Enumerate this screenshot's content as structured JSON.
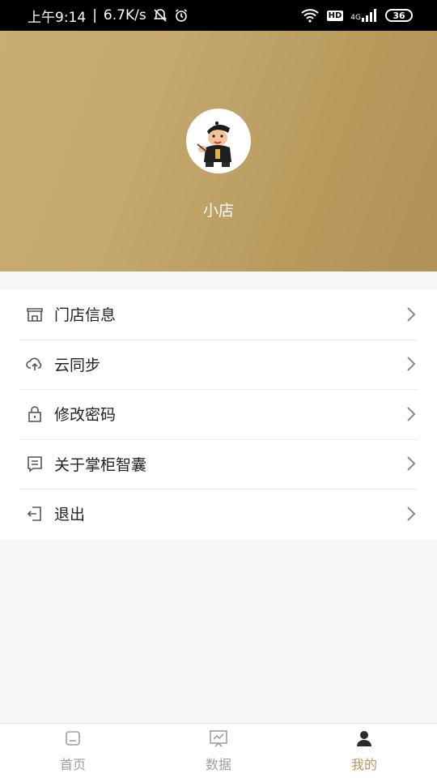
{
  "status_bar": {
    "time": "上午9:14",
    "separator": "|",
    "speed": "6.7K/s",
    "network_badge": "HD",
    "cell_label": "4G",
    "battery": "36"
  },
  "profile": {
    "shop_name": "小店"
  },
  "menu": {
    "items": [
      {
        "label": "门店信息",
        "icon": "store-icon"
      },
      {
        "label": "云同步",
        "icon": "cloud-sync-icon"
      },
      {
        "label": "修改密码",
        "icon": "lock-icon"
      },
      {
        "label": "关于掌柜智囊",
        "icon": "about-icon"
      },
      {
        "label": "退出",
        "icon": "logout-icon"
      }
    ]
  },
  "tabbar": {
    "tabs": [
      {
        "label": "首页",
        "icon": "home-icon",
        "active": false
      },
      {
        "label": "数据",
        "icon": "data-chart-icon",
        "active": false
      },
      {
        "label": "我的",
        "icon": "profile-icon",
        "active": true
      }
    ]
  },
  "colors": {
    "accent": "#b59a60",
    "hero_start": "#c9ad72",
    "hero_end": "#b0925a",
    "inactive_tab": "#9a9ea6"
  }
}
